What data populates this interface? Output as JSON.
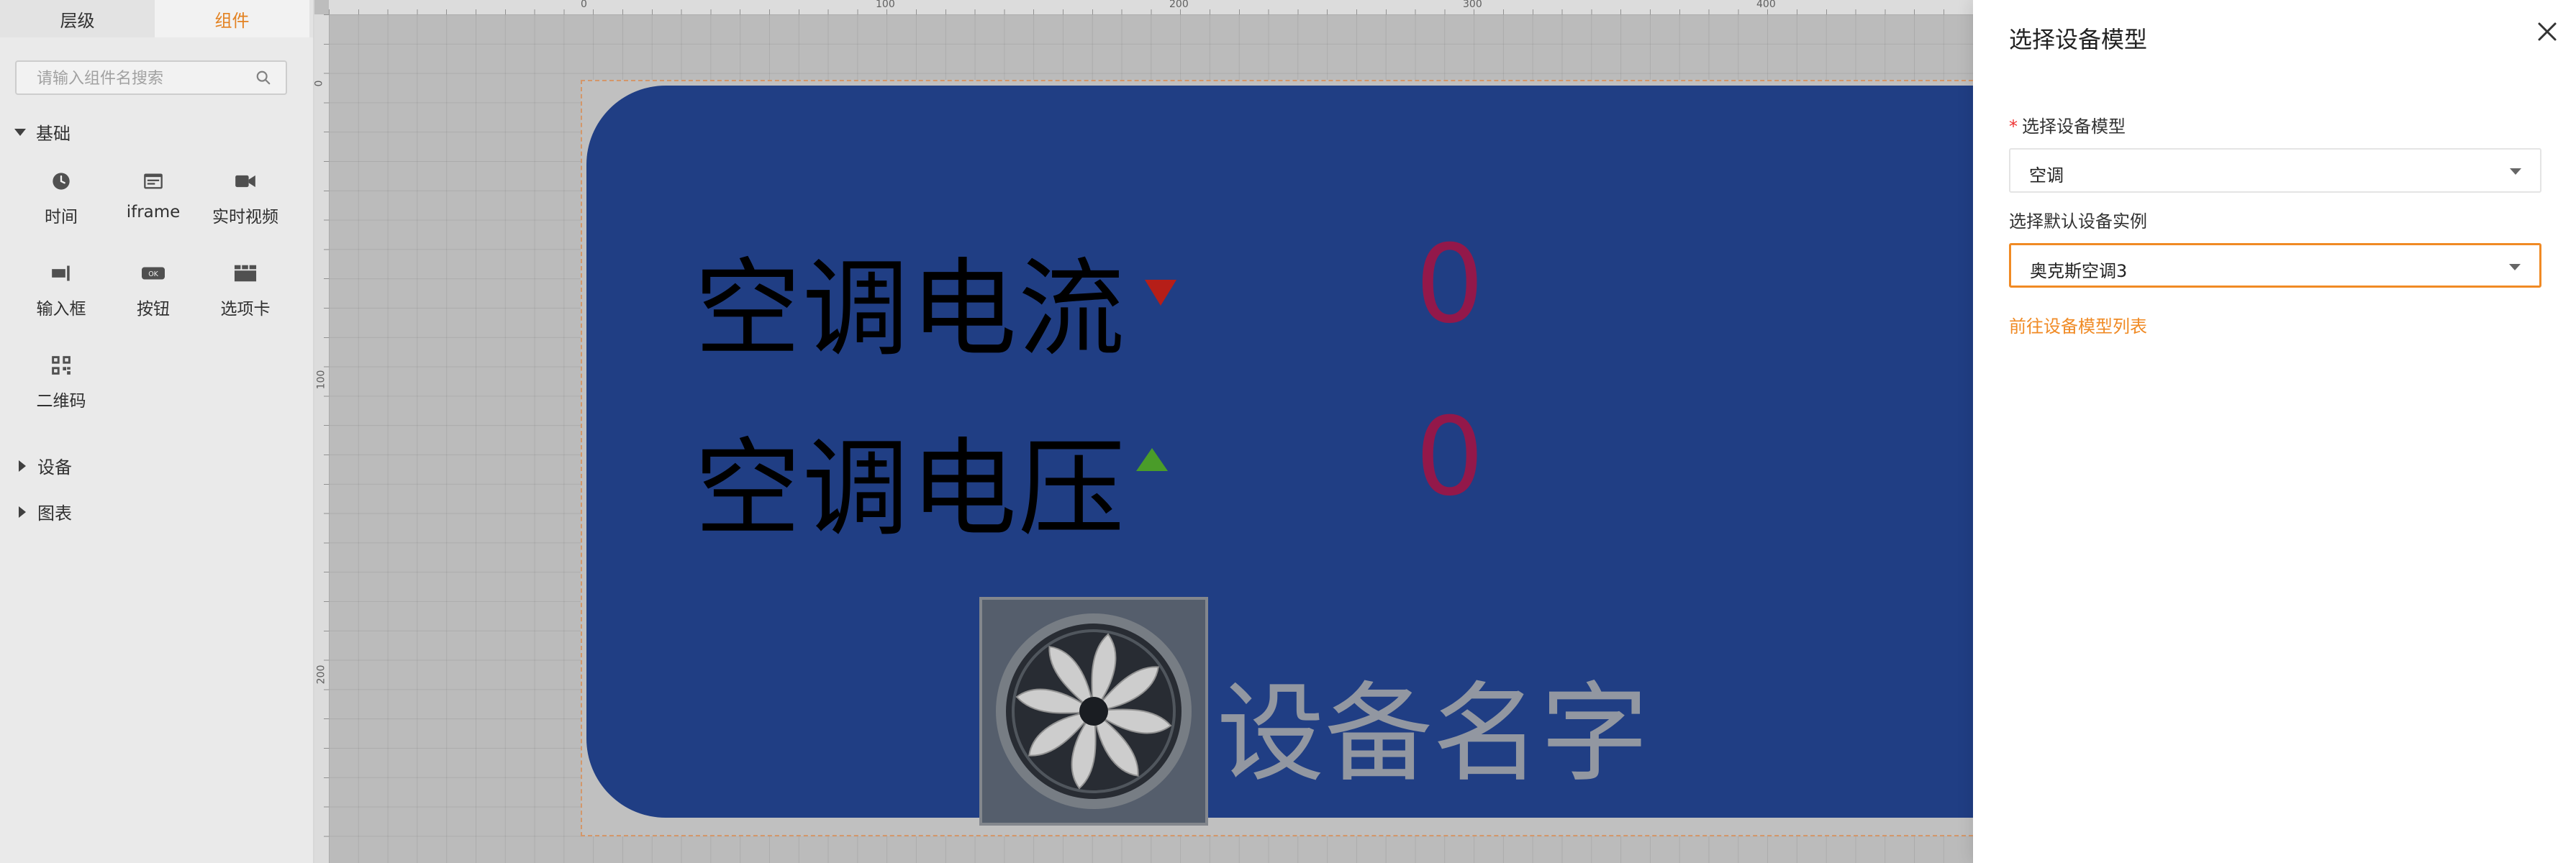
{
  "left_panel": {
    "tabs": [
      {
        "label": "层级",
        "active": false
      },
      {
        "label": "组件",
        "active": true
      }
    ],
    "search": {
      "placeholder": "请输入组件名搜索",
      "value": ""
    },
    "sections": {
      "basic": {
        "label": "基础",
        "expanded": true,
        "items": [
          {
            "label": "时间",
            "icon": "clock-icon"
          },
          {
            "label": "iframe",
            "icon": "iframe-icon"
          },
          {
            "label": "实时视频",
            "icon": "video-camera-icon"
          },
          {
            "label": "输入框",
            "icon": "input-box-icon"
          },
          {
            "label": "按钮",
            "icon": "ok-button-icon"
          },
          {
            "label": "选项卡",
            "icon": "tabs-icon"
          },
          {
            "label": "二维码",
            "icon": "qrcode-icon"
          }
        ]
      },
      "device": {
        "label": "设备",
        "expanded": false
      },
      "chart": {
        "label": "图表",
        "expanded": false
      }
    }
  },
  "canvas": {
    "ruler_top": [
      "0",
      "100",
      "200",
      "300",
      "400"
    ],
    "ruler_left": [
      "0",
      "100",
      "200"
    ],
    "rows": [
      {
        "label": "空调电流",
        "value": "0",
        "trend": "down",
        "trend_color": "#c0201a"
      },
      {
        "label": "空调电压",
        "value": "0",
        "trend": "up",
        "trend_color": "#4ea52c"
      }
    ],
    "device_name": "设备名字",
    "card_color": "#22428c",
    "value_color": "#9b1a4f"
  },
  "drawer": {
    "title": "选择设备模型",
    "model_field": {
      "label": "选择设备模型",
      "required": true,
      "value": "空调"
    },
    "instance_field": {
      "label": "选择默认设备实例",
      "required": false,
      "value": "奥克斯空调3"
    },
    "link_label": "前往设备模型列表",
    "accent_color": "#f08a24"
  }
}
